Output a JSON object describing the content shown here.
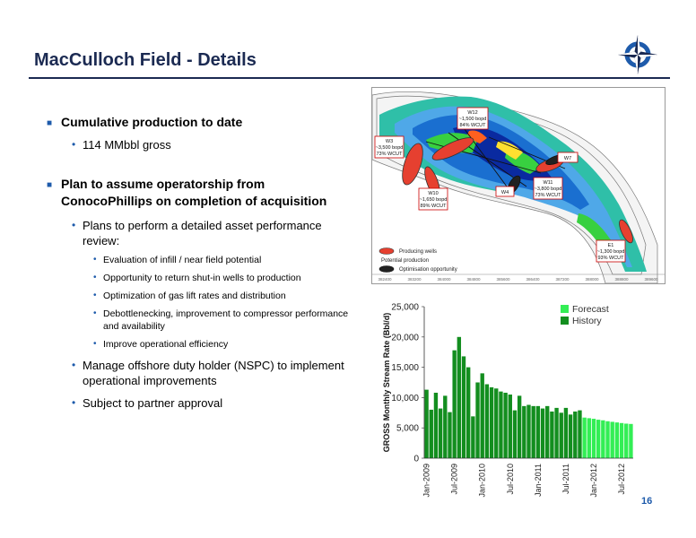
{
  "header": {
    "title": "MacCulloch Field - Details",
    "slide_number": "16"
  },
  "bullets": {
    "cum_heading": "Cumulative production to date",
    "cum_value": "114 MMbbl gross",
    "plan_heading": "Plan to assume operatorship from ConocoPhillips on completion of acquisition",
    "review_heading": "Plans to perform a detailed asset performance review:",
    "review_items": [
      "Evaluation of infill / near field potential",
      "Opportunity to return shut-in wells to production",
      "Optimization of gas lift rates and distribution",
      "Debottlenecking, improvement to compressor performance and availability",
      "Improve operational efficiency"
    ],
    "duty_holder": "Manage offshore duty holder (NSPC) to implement operational improvements",
    "partner": "Subject to partner approval"
  },
  "map": {
    "legend_producing": "Producing wells",
    "legend_potential_1": "Potential production",
    "legend_potential_2": "Optimisation opportunity",
    "wells": {
      "w12": [
        "W12",
        "~1,500 bopd",
        "84% WCUT"
      ],
      "w3": [
        "W3",
        "~3,500 bopd",
        "73% WCUT"
      ],
      "w7": [
        "W7"
      ],
      "w10": [
        "W10",
        "~1,650 bopd",
        "89% WCUT"
      ],
      "w4": [
        "W4"
      ],
      "w11": [
        "W11",
        "~3,800 bopd",
        "73% WCUT"
      ],
      "e1": [
        "E1",
        "~1,300 bopd",
        "93% WCUT"
      ]
    },
    "xticks": [
      "382400",
      "383200",
      "384000",
      "384800",
      "385600",
      "386400",
      "387200",
      "388000",
      "388800",
      "389600"
    ]
  },
  "chart_data": {
    "type": "bar",
    "ylabel": "GROSS Monthly Stream Rate (Bbl/d)",
    "ylim": [
      0,
      25000
    ],
    "yticks": [
      "25,000",
      "20,000",
      "15,000",
      "10,000",
      "5,000",
      "0"
    ],
    "xtick_labels": [
      "Jan-2009",
      "Jul-2009",
      "Jan-2010",
      "Jul-2010",
      "Jan-2011",
      "Jul-2011",
      "Jan-2012",
      "Jul-2012"
    ],
    "legend": [
      "Forecast",
      "History"
    ],
    "colors": {
      "history": "#138e1f",
      "forecast": "#33ee55"
    },
    "series": [
      {
        "name": "History",
        "values": [
          11300,
          8000,
          10800,
          8200,
          10300,
          7600,
          17800,
          20000,
          16800,
          15000,
          6900,
          12500,
          14000,
          12200,
          11700,
          11500,
          11000,
          10800,
          10500,
          7900,
          10300,
          8600,
          8800,
          8600,
          8600,
          8200,
          8600,
          7700,
          8300,
          7500,
          8300,
          7200,
          7700,
          7900
        ]
      },
      {
        "name": "Forecast",
        "values": [
          6700,
          6600,
          6500,
          6350,
          6250,
          6100,
          6000,
          5900,
          5800,
          5700,
          5650
        ]
      }
    ]
  }
}
